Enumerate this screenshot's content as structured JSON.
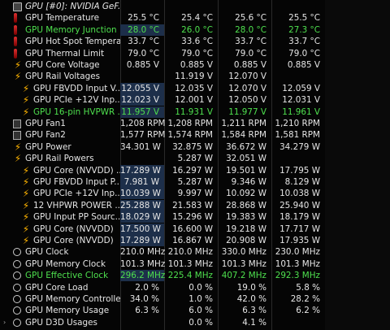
{
  "rows": [
    {
      "id": "gpu-header",
      "name": "GPU [#0]: NVIDIA GeF...",
      "icon": "gpu-chip-icon",
      "values": [
        "",
        "",
        "",
        ""
      ],
      "style": "header"
    },
    {
      "id": "gpu-temperature",
      "name": "GPU Temperature",
      "icon": "thermometer-icon",
      "values": [
        "25.5 °C",
        "25.4 °C",
        "25.6 °C",
        "25.5 °C"
      ]
    },
    {
      "id": "gpu-memory-junction",
      "name": "GPU Memory Junction ...",
      "icon": "thermometer-icon",
      "values": [
        "28.0 °C",
        "26.0 °C",
        "28.0 °C",
        "27.3 °C"
      ],
      "style": "green"
    },
    {
      "id": "gpu-hot-spot",
      "name": "GPU Hot Spot Tempera...",
      "icon": "thermometer-icon",
      "values": [
        "33.7 °C",
        "33.6 °C",
        "33.7 °C",
        "33.7 °C"
      ]
    },
    {
      "id": "gpu-thermal-limit",
      "name": "GPU Thermal Limit",
      "icon": "thermometer-icon",
      "values": [
        "79.0 °C",
        "79.0 °C",
        "79.0 °C",
        "79.0 °C"
      ]
    },
    {
      "id": "gpu-core-voltage",
      "name": "GPU Core Voltage",
      "icon": "bolt-icon",
      "values": [
        "0.885 V",
        "0.885 V",
        "0.885 V",
        "0.885 V"
      ]
    },
    {
      "id": "gpu-rail-voltages",
      "name": "GPU Rail Voltages",
      "icon": "bolt-icon",
      "values": [
        "",
        "11.919 V",
        "12.070 V",
        ""
      ]
    },
    {
      "id": "gpu-fbvdd-input-v",
      "name": "GPU FBVDD Input V...",
      "icon": "bolt-icon",
      "values": [
        "12.055 V",
        "12.035 V",
        "12.070 V",
        "12.059 V"
      ],
      "indent": true
    },
    {
      "id": "gpu-pcie-12v-v",
      "name": "GPU PCIe +12V Inp...",
      "icon": "bolt-icon",
      "values": [
        "12.023 V",
        "12.001 V",
        "12.050 V",
        "12.031 V"
      ],
      "indent": true
    },
    {
      "id": "gpu-16pin-hvpwr",
      "name": "GPU 16-pin HVPWR ...",
      "icon": "bolt-icon",
      "values": [
        "11.957 V",
        "11.931 V",
        "11.977 V",
        "11.961 V"
      ],
      "indent": true,
      "style": "green"
    },
    {
      "id": "gpu-fan1",
      "name": "GPU Fan1",
      "icon": "fan-icon",
      "values": [
        "1,208 RPM",
        "1,208 RPM",
        "1,211 RPM",
        "1,210 RPM"
      ]
    },
    {
      "id": "gpu-fan2",
      "name": "GPU Fan2",
      "icon": "fan-icon",
      "values": [
        "1,577 RPM",
        "1,574 RPM",
        "1,584 RPM",
        "1,581 RPM"
      ]
    },
    {
      "id": "gpu-power",
      "name": "GPU Power",
      "icon": "bolt-icon",
      "values": [
        "34.301 W",
        "32.875 W",
        "36.672 W",
        "34.279 W"
      ]
    },
    {
      "id": "gpu-rail-powers",
      "name": "GPU Rail Powers",
      "icon": "bolt-icon",
      "values": [
        "",
        "5.287 W",
        "32.051 W",
        ""
      ]
    },
    {
      "id": "gpu-core-nvvdd-1",
      "name": "GPU Core (NVVDD) ...",
      "icon": "bolt-icon",
      "values": [
        "17.289 W",
        "16.297 W",
        "19.501 W",
        "17.795 W"
      ],
      "indent": true
    },
    {
      "id": "gpu-fbvdd-input-p",
      "name": "GPU FBVDD Input P...",
      "icon": "bolt-icon",
      "values": [
        "7.981 W",
        "5.287 W",
        "9.346 W",
        "8.129 W"
      ],
      "indent": true
    },
    {
      "id": "gpu-pcie-12v-p",
      "name": "GPU PCIe +12V Inp...",
      "icon": "bolt-icon",
      "values": [
        "10.039 W",
        "9.997 W",
        "10.092 W",
        "10.038 W"
      ],
      "indent": true
    },
    {
      "id": "vhpwr-power",
      "name": "12 VHPWR POWER ...",
      "icon": "bolt-icon",
      "values": [
        "25.288 W",
        "21.583 W",
        "28.868 W",
        "25.940 W"
      ],
      "indent": true
    },
    {
      "id": "gpu-input-pp-source",
      "name": "GPU Input PP Sourc...",
      "icon": "bolt-icon",
      "values": [
        "18.029 W",
        "15.296 W",
        "19.383 W",
        "18.179 W"
      ],
      "indent": true
    },
    {
      "id": "gpu-core-nvvdd-2",
      "name": "GPU Core (NVVDD)",
      "icon": "bolt-icon",
      "values": [
        "17.500 W",
        "16.600 W",
        "19.218 W",
        "17.717 W"
      ],
      "indent": true
    },
    {
      "id": "gpu-core-nvvdd-3",
      "name": "GPU Core (NVVDD)",
      "icon": "bolt-icon",
      "values": [
        "17.289 W",
        "16.867 W",
        "20.908 W",
        "17.935 W"
      ],
      "indent": true
    },
    {
      "id": "gpu-clock",
      "name": "GPU Clock",
      "icon": "clock-icon",
      "values": [
        "210.0 MHz",
        "210.0 MHz",
        "330.0 MHz",
        "230.0 MHz"
      ]
    },
    {
      "id": "gpu-memory-clock",
      "name": "GPU Memory Clock",
      "icon": "clock-icon",
      "values": [
        "101.3 MHz",
        "101.3 MHz",
        "101.3 MHz",
        "101.3 MHz"
      ]
    },
    {
      "id": "gpu-effective-clock",
      "name": "GPU Effective Clock",
      "icon": "clock-icon",
      "values": [
        "296.2 MHz",
        "225.4 MHz",
        "407.2 MHz",
        "292.3 MHz"
      ],
      "style": "green"
    },
    {
      "id": "gpu-core-load",
      "name": "GPU Core Load",
      "icon": "clock-icon",
      "values": [
        "2.0 %",
        "0.0 %",
        "19.0 %",
        "5.8 %"
      ]
    },
    {
      "id": "gpu-memory-controller",
      "name": "GPU Memory Controller...",
      "icon": "clock-icon",
      "values": [
        "34.0 %",
        "1.0 %",
        "42.0 %",
        "28.2 %"
      ]
    },
    {
      "id": "gpu-memory-usage",
      "name": "GPU Memory Usage",
      "icon": "clock-icon",
      "values": [
        "6.3 %",
        "6.0 %",
        "6.3 %",
        "6.2 %"
      ]
    },
    {
      "id": "gpu-d3d-usages",
      "name": "GPU D3D Usages",
      "icon": "clock-icon",
      "values": [
        "",
        "0.0 %",
        "4.1 %",
        ""
      ],
      "expander": "›"
    }
  ]
}
